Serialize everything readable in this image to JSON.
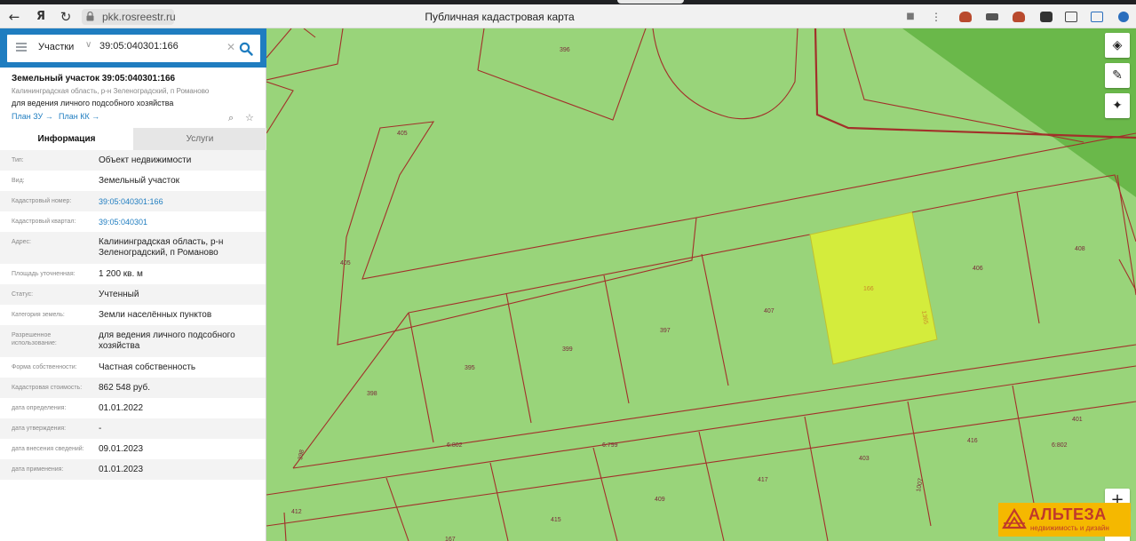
{
  "browser": {
    "url": "pkk.rosreestr.ru",
    "title": "Публичная кадастровая карта",
    "back_glyph": "←",
    "yandex_glyph": "Я",
    "reload_glyph": "↻",
    "bookmark_glyph": "■",
    "menu_glyph": "⋮",
    "icons": [
      "back-icon",
      "yandex-icon",
      "reload-icon",
      "lock-icon",
      "bookmark-icon",
      "menu-icon",
      "extension-icon"
    ]
  },
  "search": {
    "menu_icon": "hamburger-icon",
    "type_label": "Участки",
    "chevron": "∨",
    "value": "39:05:040301:166",
    "clear_glyph": "✕",
    "search_icon": "search-icon",
    "collapse_glyph": "‹",
    "accent": "#1f7dc0"
  },
  "parcel": {
    "title": "Земельный участок 39:05:040301:166",
    "address": "Калининградская область, р-н Зеленоградский, п Романово",
    "use": "для ведения личного подсобного хозяйства",
    "links": [
      "План ЗУ →",
      "План КК →"
    ],
    "zoom_glyph": "⌕",
    "star_glyph": "☆"
  },
  "tabs": [
    {
      "label": "Информация",
      "active": true
    },
    {
      "label": "Услуги",
      "active": false
    }
  ],
  "properties": [
    {
      "label": "Тип:",
      "value": "Объект недвижимости",
      "link": false
    },
    {
      "label": "Вид:",
      "value": "Земельный участок",
      "link": false
    },
    {
      "label": "Кадастровый номер:",
      "value": "39:05:040301:166",
      "link": true
    },
    {
      "label": "Кадастровый квартал:",
      "value": "39:05:040301",
      "link": true
    },
    {
      "label": "Адрес:",
      "value": "Калининградская область, р-н Зеленоградский, п Романово",
      "link": false
    },
    {
      "label": "Площадь уточненная:",
      "value": "1 200 кв. м",
      "link": false
    },
    {
      "label": "Статус:",
      "value": "Учтенный",
      "link": false
    },
    {
      "label": "Категория земель:",
      "value": "Земли населённых пунктов",
      "link": false
    },
    {
      "label": "Разрешенное использование:",
      "value": "для ведения личного подсобного хозяйства",
      "link": false
    },
    {
      "label": "Форма собственности:",
      "value": "Частная собственность",
      "link": false
    },
    {
      "label": "Кадастровая стоимость:",
      "value": "862 548 руб.",
      "link": false
    },
    {
      "label": "дата определения:",
      "value": "01.01.2022",
      "link": false
    },
    {
      "label": "дата утверждения:",
      "value": "-",
      "link": false
    },
    {
      "label": "дата внесения сведений:",
      "value": "09.01.2023",
      "link": false
    },
    {
      "label": "дата применения:",
      "value": "01.01.2023",
      "link": false
    }
  ],
  "map": {
    "colors": {
      "land": "#99d47a",
      "forest": "#6ab84a",
      "border": "#a2302a",
      "selected": "#d4ec3c"
    },
    "parcel_labels": [
      "396",
      "405",
      "405",
      "166",
      "1365",
      "406",
      "408",
      "407",
      "397",
      "399",
      "395",
      "398",
      "398",
      "401",
      "416",
      "403",
      "417",
      "409",
      "415",
      "412",
      "167",
      "6:802",
      "6:799",
      "6:802",
      "1007"
    ],
    "controls": {
      "layers_glyph": "◈",
      "ruler_glyph": "✎",
      "locate_glyph": "✦",
      "zoom_in_glyph": "+",
      "zoom_out_glyph": "−"
    }
  },
  "watermark": {
    "name": "АЛЬТЕЗА",
    "tagline": "недвижимость и дизайн"
  }
}
